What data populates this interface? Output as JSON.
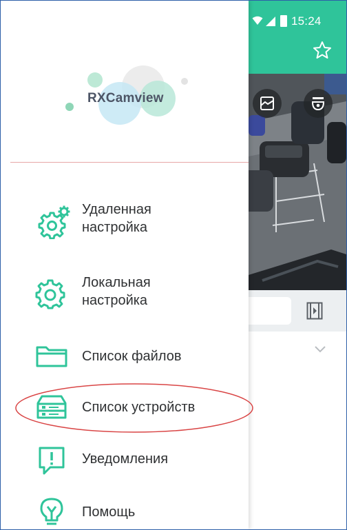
{
  "status_bar": {
    "time": "15:24"
  },
  "app": {
    "icons": {
      "favorite": "star-icon",
      "snapshot": "snapshot-icon",
      "ptz": "dome-camera-icon",
      "video": "video-playback-icon",
      "expand": "chevron-down-icon"
    }
  },
  "drawer": {
    "logo_text": "RXCamview",
    "items": [
      {
        "id": "remote-settings",
        "label": "Удаленная\nнастройка",
        "icon": "gears-icon"
      },
      {
        "id": "local-settings",
        "label": "Локальная\nнастройка",
        "icon": "gear-icon"
      },
      {
        "id": "file-list",
        "label": "Список файлов",
        "icon": "folder-icon"
      },
      {
        "id": "device-list",
        "label": "Список устройств",
        "icon": "dvr-device-icon",
        "highlighted": true
      },
      {
        "id": "notifications",
        "label": "Уведомления",
        "icon": "alert-message-icon"
      },
      {
        "id": "help",
        "label": "Помощь",
        "icon": "lightbulb-icon"
      }
    ]
  },
  "colors": {
    "accent": "#2fc49a",
    "divider": "#e8a7a6",
    "annotation": "#d94444",
    "text": "#2f3133"
  }
}
